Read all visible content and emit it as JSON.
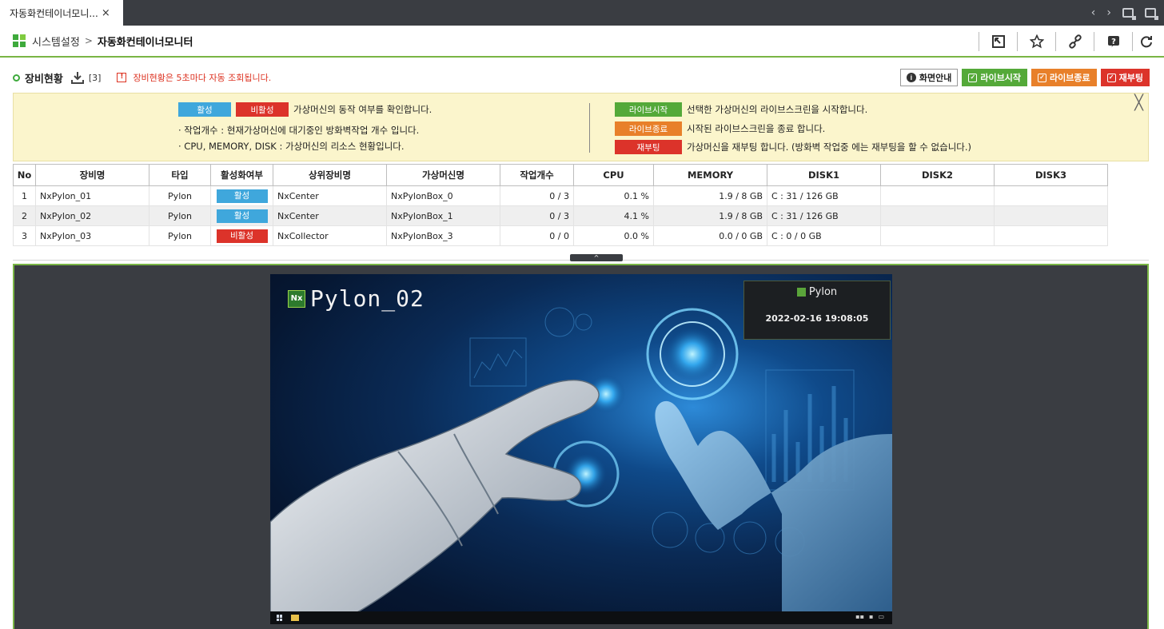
{
  "tabs": [
    {
      "label": "자동화컨테이너모니...",
      "close": "×"
    }
  ],
  "tabbar_nav": {
    "prev": "‹",
    "next": "›"
  },
  "breadcrumb": {
    "parent": "시스템설정",
    "separator": ">",
    "current": "자동화컨테이너모니터"
  },
  "section": {
    "title": "장비현황",
    "count": "[3]",
    "notice_icon": "!",
    "notice": "장비현황은 5초마다 자동 조회됩니다."
  },
  "actions": {
    "guide": "화면안내",
    "live_start": "라이브시작",
    "live_stop": "라이브종료",
    "reboot": "재부팅"
  },
  "guide": {
    "badge_active": "활성",
    "badge_inactive": "비활성",
    "status_desc": "가상머신의 동작 여부를 확인합니다.",
    "job_count_desc": "· 작업개수 : 현재가상머신에 대기중인 방화벽작업 개수 입니다.",
    "resource_desc": "· CPU, MEMORY, DISK : 가상머신의 리소스 현황입니다.",
    "pill_start": "라이브시작",
    "start_desc": "선택한 가상머신의 라이브스크린을 시작합니다.",
    "pill_stop": "라이브종료",
    "stop_desc": "시작된 라이브스크린을 종료 합니다.",
    "pill_reboot": "재부팅",
    "reboot_desc": "가상머신을 재부팅 합니다. (방화벽 작업중 에는 재부팅을 할 수 없습니다.)",
    "close": "╳"
  },
  "table": {
    "headers": [
      "No",
      "장비명",
      "타입",
      "활성화여부",
      "상위장비명",
      "가상머신명",
      "작업개수",
      "CPU",
      "MEMORY",
      "DISK1",
      "DISK2",
      "DISK3"
    ],
    "rows": [
      {
        "no": "1",
        "name": "NxPylon_01",
        "type": "Pylon",
        "status": "활성",
        "active": true,
        "parent": "NxCenter",
        "vm": "NxPylonBox_0",
        "jobs": "0 / 3",
        "cpu": "0.1 %",
        "memory": "1.9 / 8 GB",
        "disk1": "C : 31 / 126 GB",
        "disk2": "",
        "disk3": ""
      },
      {
        "no": "2",
        "name": "NxPylon_02",
        "type": "Pylon",
        "status": "활성",
        "active": true,
        "parent": "NxCenter",
        "vm": "NxPylonBox_1",
        "jobs": "0 / 3",
        "cpu": "4.1 %",
        "memory": "1.9 / 8 GB",
        "disk1": "C : 31 / 126 GB",
        "disk2": "",
        "disk3": ""
      },
      {
        "no": "3",
        "name": "NxPylon_03",
        "type": "Pylon",
        "status": "비활성",
        "active": false,
        "parent": "NxCollector",
        "vm": "NxPylonBox_3",
        "jobs": "0 / 0",
        "cpu": "0.0 %",
        "memory": "0.0 / 0 GB",
        "disk1": "C : 0 / 0 GB",
        "disk2": "",
        "disk3": ""
      }
    ]
  },
  "splitter": {
    "label": "^"
  },
  "viewer": {
    "vm_title": "Pylon_02",
    "logo_text": "Nx",
    "brand": "Pylon",
    "datetime": "2022-02-16  19:08:05"
  },
  "colors": {
    "accent_green": "#79b545",
    "active_blue": "#3fa7dc",
    "inactive_red": "#dc332a",
    "start_green": "#54a939",
    "stop_orange": "#e8802a",
    "guide_bg": "#fbf5cc"
  }
}
